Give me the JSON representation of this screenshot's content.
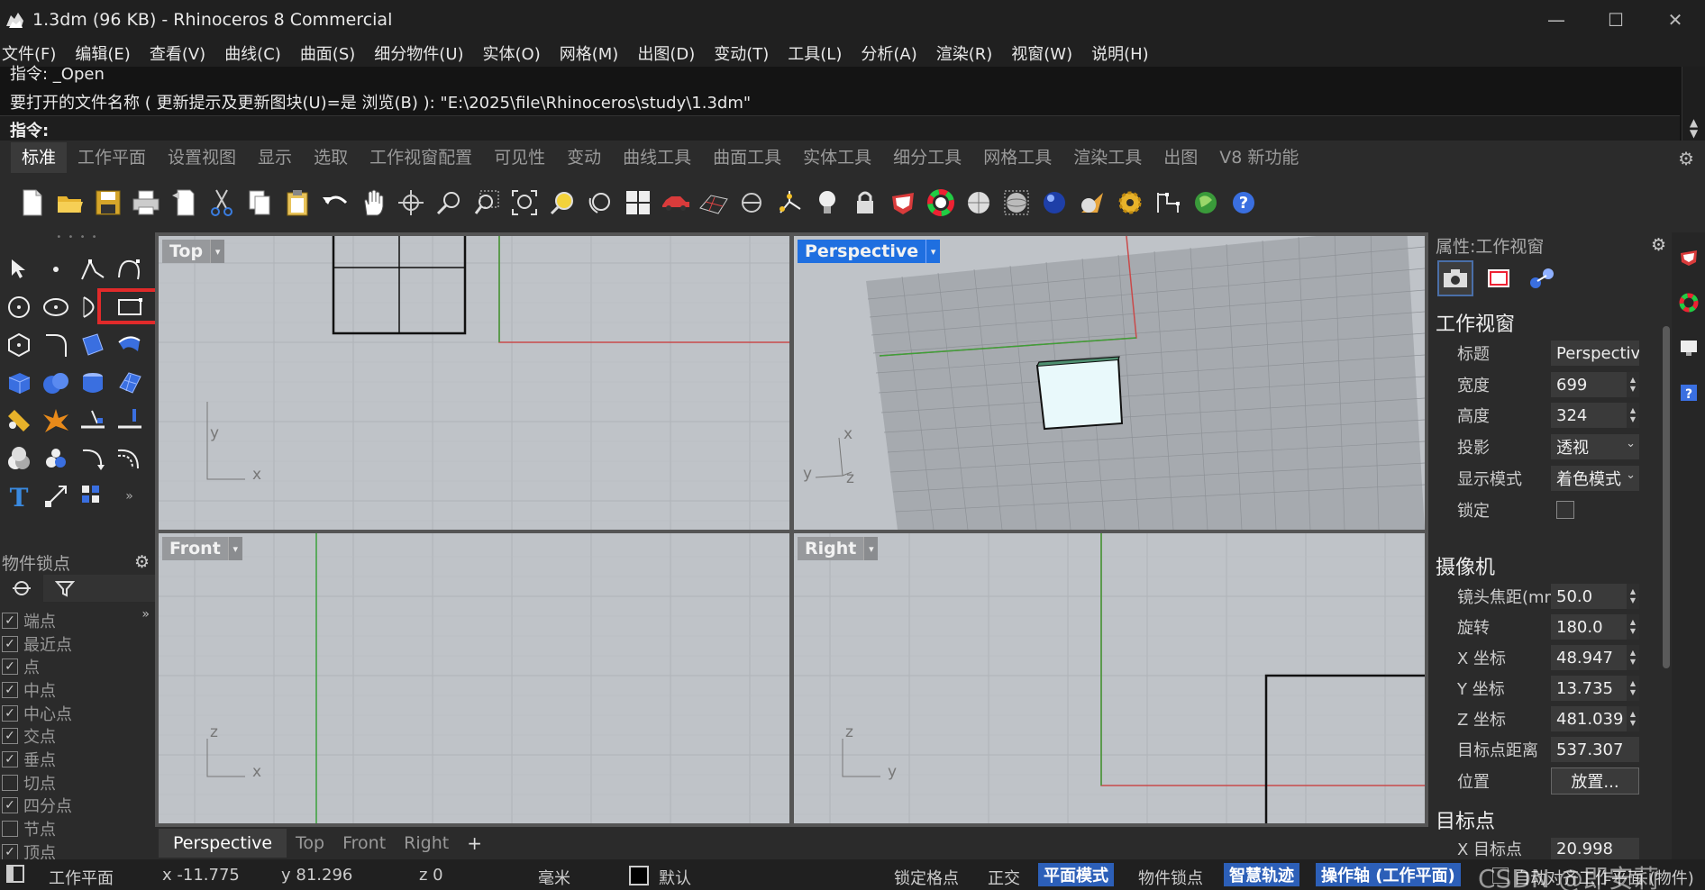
{
  "window": {
    "title": "1.3dm (96 KB) - Rhinoceros 8 Commercial",
    "controls": [
      "—",
      "☐",
      "✕"
    ]
  },
  "menu": [
    "文件(F)",
    "编辑(E)",
    "查看(V)",
    "曲线(C)",
    "曲面(S)",
    "细分物件(U)",
    "实体(O)",
    "网格(M)",
    "出图(D)",
    "变动(T)",
    "工具(L)",
    "分析(A)",
    "渲染(R)",
    "视窗(W)",
    "说明(H)"
  ],
  "command": {
    "history_1": "指令: _Open",
    "history_2": "要打开的文件名称 ( 更新提示及更新图块(U)=是  浏览(B) ): \"E:\\2025\\file\\Rhinoceros\\study\\1.3dm\"",
    "prompt_label": "指令:",
    "scroll_up": "▲",
    "scroll_down": "▼"
  },
  "toolbar_tabs": [
    "标准",
    "工作平面",
    "设置视图",
    "显示",
    "选取",
    "工作视窗配置",
    "可见性",
    "变动",
    "曲线工具",
    "曲面工具",
    "实体工具",
    "细分工具",
    "网格工具",
    "渲染工具",
    "出图",
    "V8 新功能"
  ],
  "toolbar_tabs_gear": "⚙",
  "toolbar_icons": [
    "new-file",
    "open-file",
    "save",
    "print",
    "import",
    "cut",
    "copy",
    "paste",
    "undo",
    "pan",
    "rotate-view",
    "zoom",
    "zoom-window",
    "zoom-extents",
    "zoom-selected",
    "rotate-camera",
    "four-viewports",
    "car",
    "grid-plane",
    "osnap",
    "axes",
    "light",
    "lock",
    "render-tag",
    "color-wheel",
    "sphere-shaded",
    "sphere-wire",
    "sphere-blue",
    "sphere-gold",
    "gear-settings",
    "dimension",
    "globe",
    "help"
  ],
  "palette": {
    "grip": "• • • •",
    "tools": [
      "select",
      "point",
      "polyline",
      "curve",
      "circle",
      "ellipse",
      "arc",
      "rectangle",
      "polygon",
      "fillet",
      "surface",
      "sweep",
      "box",
      "sphere",
      "cylinder",
      "mesh-surface",
      "transform",
      "explode",
      "split",
      "trim",
      "boolean",
      "group",
      "rotate",
      "offset",
      "text",
      "scale",
      "array",
      "more"
    ],
    "highlight_tool": "rectangle"
  },
  "osnap": {
    "title": "物件锁点",
    "items": [
      {
        "label": "端点",
        "checked": true
      },
      {
        "label": "最近点",
        "checked": true
      },
      {
        "label": "点",
        "checked": true
      },
      {
        "label": "中点",
        "checked": true
      },
      {
        "label": "中心点",
        "checked": true
      },
      {
        "label": "交点",
        "checked": true
      },
      {
        "label": "垂点",
        "checked": true
      },
      {
        "label": "切点",
        "checked": false
      },
      {
        "label": "四分点",
        "checked": true
      },
      {
        "label": "节点",
        "checked": false
      },
      {
        "label": "顶点",
        "checked": true
      }
    ],
    "more": "»"
  },
  "viewports": {
    "top": {
      "label": "Top",
      "axis_x": "x",
      "axis_y": "y"
    },
    "perspective": {
      "label": "Perspective",
      "axis_x": "x",
      "axis_y": "y",
      "axis_z": "z"
    },
    "front": {
      "label": "Front",
      "axis_x": "x",
      "axis_z": "z"
    },
    "right": {
      "label": "Right",
      "axis_y": "y",
      "axis_z": "z"
    },
    "dropdown": "▾"
  },
  "viewport_tabs": [
    "Perspective",
    "Top",
    "Front",
    "Right"
  ],
  "viewport_tabs_add": "+",
  "properties": {
    "title": "属性:工作视窗",
    "section_viewport": "工作视窗",
    "section_camera": "摄像机",
    "section_target": "目标点",
    "rows": {
      "title_k": "标题",
      "title_v": "Perspective",
      "width_k": "宽度",
      "width_v": "699",
      "height_k": "高度",
      "height_v": "324",
      "projection_k": "投影",
      "projection_v": "透视",
      "display_k": "显示模式",
      "display_v": "着色模式",
      "lock_k": "锁定",
      "focal_k": "镜头焦距(mm)",
      "focal_v": "50.0",
      "rotation_k": "旋转",
      "rotation_v": "180.0",
      "x_k": "X 坐标",
      "x_v": "48.947",
      "y_k": "Y 坐标",
      "y_v": "13.735",
      "z_k": "Z 坐标",
      "z_v": "481.039",
      "dist_k": "目标点距离",
      "dist_v": "537.307",
      "pos_k": "位置",
      "pos_btn": "放置...",
      "tx_k": "X 目标点",
      "tx_v": "20.998"
    }
  },
  "status": {
    "cplane": "工作平面",
    "x": "x -11.775",
    "y": "y 81.296",
    "z": "z 0",
    "unit": "毫米",
    "layer": "默认",
    "grid_snap": "锁定格点",
    "ortho": "正交",
    "planar": "平面模式",
    "osnap": "物件锁点",
    "smarttrack": "智慧轨迹",
    "gumball": "操作轴 (工作平面)",
    "autoalign": "自动对齐工作平面 (物件)",
    "watermark": "CSDN @即安莉"
  }
}
